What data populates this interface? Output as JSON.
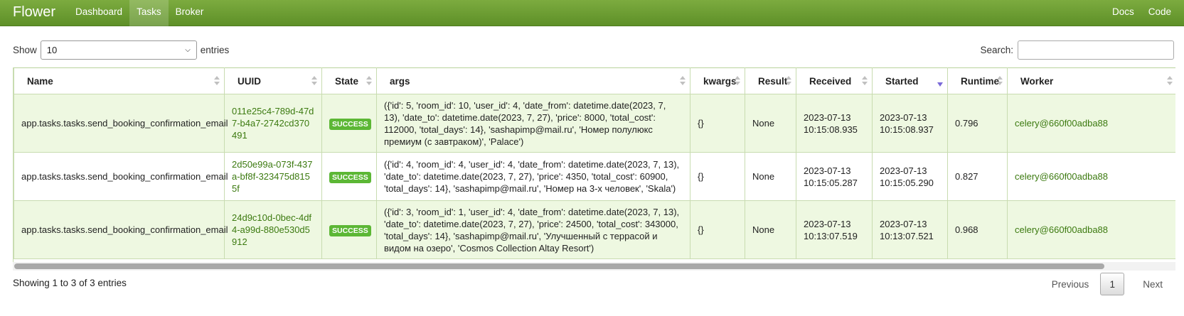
{
  "navbar": {
    "brand": "Flower",
    "links": [
      "Dashboard",
      "Tasks",
      "Broker"
    ],
    "active": "Tasks",
    "right_links": [
      "Docs",
      "Code"
    ]
  },
  "controls": {
    "show_label": "Show",
    "entries_value": "10",
    "entries_label": "entries",
    "search_label": "Search:",
    "search_value": ""
  },
  "table": {
    "columns": [
      "Name",
      "UUID",
      "State",
      "args",
      "kwargs",
      "Result",
      "Received",
      "Started",
      "Runtime",
      "Worker"
    ],
    "sorted_column": "Started",
    "rows": [
      {
        "name": "app.tasks.tasks.send_booking_confirmation_email",
        "uuid": "011e25c4-789d-47d7-b4a7-2742cd370491",
        "state": "SUCCESS",
        "args": "({'id': 5, 'room_id': 10, 'user_id': 4, 'date_from': datetime.date(2023, 7, 13), 'date_to': datetime.date(2023, 7, 27), 'price': 8000, 'total_cost': 112000, 'total_days': 14}, 'sashapimp@mail.ru', 'Номер полулюкс премиум (с завтраком)', 'Palace')",
        "kwargs": "{}",
        "result": "None",
        "received_date": "2023-07-13",
        "received_time": "10:15:08.935",
        "started_date": "2023-07-13",
        "started_time": "10:15:08.937",
        "runtime": "0.796",
        "worker": "celery@660f00adba88"
      },
      {
        "name": "app.tasks.tasks.send_booking_confirmation_email",
        "uuid": "2d50e99a-073f-437a-bf8f-323475d8155f",
        "state": "SUCCESS",
        "args": "({'id': 4, 'room_id': 4, 'user_id': 4, 'date_from': datetime.date(2023, 7, 13), 'date_to': datetime.date(2023, 7, 27), 'price': 4350, 'total_cost': 60900, 'total_days': 14}, 'sashapimp@mail.ru', 'Номер на 3-х человек', 'Skala')",
        "kwargs": "{}",
        "result": "None",
        "received_date": "2023-07-13",
        "received_time": "10:15:05.287",
        "started_date": "2023-07-13",
        "started_time": "10:15:05.290",
        "runtime": "0.827",
        "worker": "celery@660f00adba88"
      },
      {
        "name": "app.tasks.tasks.send_booking_confirmation_email",
        "uuid": "24d9c10d-0bec-4df4-a99d-880e530d5912",
        "state": "SUCCESS",
        "args": "({'id': 3, 'room_id': 1, 'user_id': 4, 'date_from': datetime.date(2023, 7, 13), 'date_to': datetime.date(2023, 7, 27), 'price': 24500, 'total_cost': 343000, 'total_days': 14}, 'sashapimp@mail.ru', 'Улучшенный с террасой и видом на озеро', 'Cosmos Collection Altay Resort')",
        "kwargs": "{}",
        "result": "None",
        "received_date": "2023-07-13",
        "received_time": "10:13:07.519",
        "started_date": "2023-07-13",
        "started_time": "10:13:07.521",
        "runtime": "0.968",
        "worker": "celery@660f00adba88"
      }
    ]
  },
  "footer": {
    "info": "Showing 1 to 3 of 3 entries",
    "previous": "Previous",
    "page": "1",
    "next": "Next"
  },
  "colors": {
    "navbar": "#6a9b32",
    "link_green": "#3c7a10",
    "success_badge": "#5cb735",
    "odd_row": "#eef8e1"
  }
}
